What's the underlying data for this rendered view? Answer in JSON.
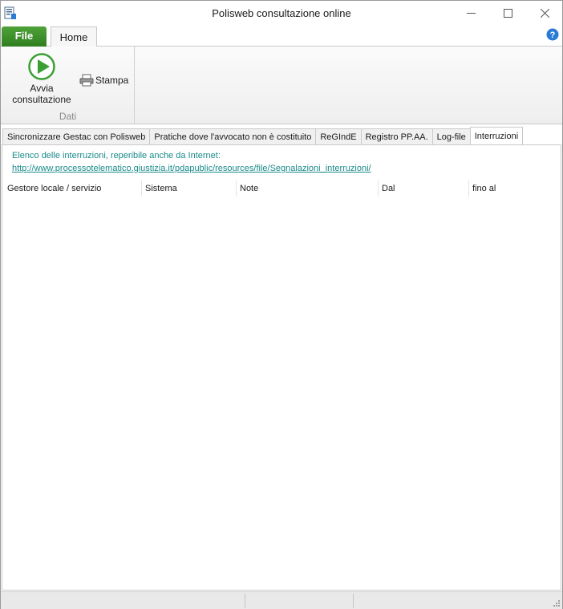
{
  "window": {
    "title": "Polisweb consultazione online"
  },
  "ribbon": {
    "file_tab": "File",
    "home_tab": "Home",
    "buttons": {
      "avvia_line1": "Avvia",
      "avvia_line2": "consultazione",
      "stampa": "Stampa"
    },
    "group_label": "Dati"
  },
  "tabs": [
    {
      "label": "Sincronizzare Gestac con Polisweb"
    },
    {
      "label": "Pratiche dove l'avvocato non è costituito"
    },
    {
      "label": "ReGIndE"
    },
    {
      "label": "Registro PP.AA."
    },
    {
      "label": "Log-file"
    },
    {
      "label": "Interruzioni",
      "active": true
    }
  ],
  "interruzioni": {
    "info_text": "Elenco delle interruzioni, reperibile anche da Internet:",
    "link": "http://www.processotelematico.giustizia.it/pdapublic/resources/file/Segnalazioni_interruzioni/",
    "columns": [
      "Gestore locale / servizio",
      "Sistema",
      "Note",
      "Dal",
      "fino al"
    ]
  },
  "icons": {
    "app": "app-icon",
    "minimize": "minimize-icon",
    "maximize": "maximize-icon",
    "close": "close-icon",
    "help": "help-icon",
    "play": "play-icon",
    "printer": "printer-icon"
  },
  "colors": {
    "file_tab": "#3d9130",
    "play_green": "#3aa033",
    "link_teal": "#1b8a8a",
    "help_blue": "#2a7bd6"
  }
}
